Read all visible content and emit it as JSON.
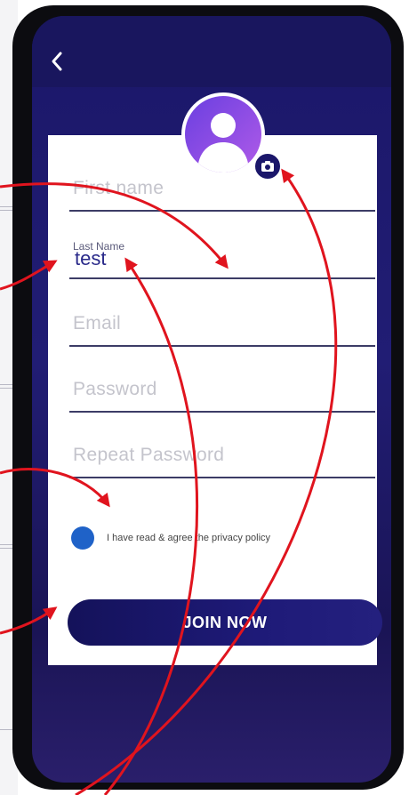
{
  "screen": {
    "back_icon": "chevron-left-icon",
    "profile_icon": "user-avatar-icon",
    "camera_icon": "camera-icon"
  },
  "form": {
    "first_name": {
      "placeholder": "First name",
      "value": ""
    },
    "last_name": {
      "label": "Last Name",
      "value": "test"
    },
    "email": {
      "placeholder": "Email",
      "value": ""
    },
    "password": {
      "placeholder": "Password",
      "value": ""
    },
    "repeat_password": {
      "placeholder": "Repeat Password",
      "value": ""
    },
    "privacy_text": "I have read & agree the privacy policy",
    "join_label": "JOIN NOW"
  },
  "colors": {
    "primary": "#1b176a",
    "annotation_arrow": "#e0141e",
    "checkbox": "#1f62c8",
    "avatar_start": "#6a3fe0",
    "avatar_end": "#b05be8"
  }
}
